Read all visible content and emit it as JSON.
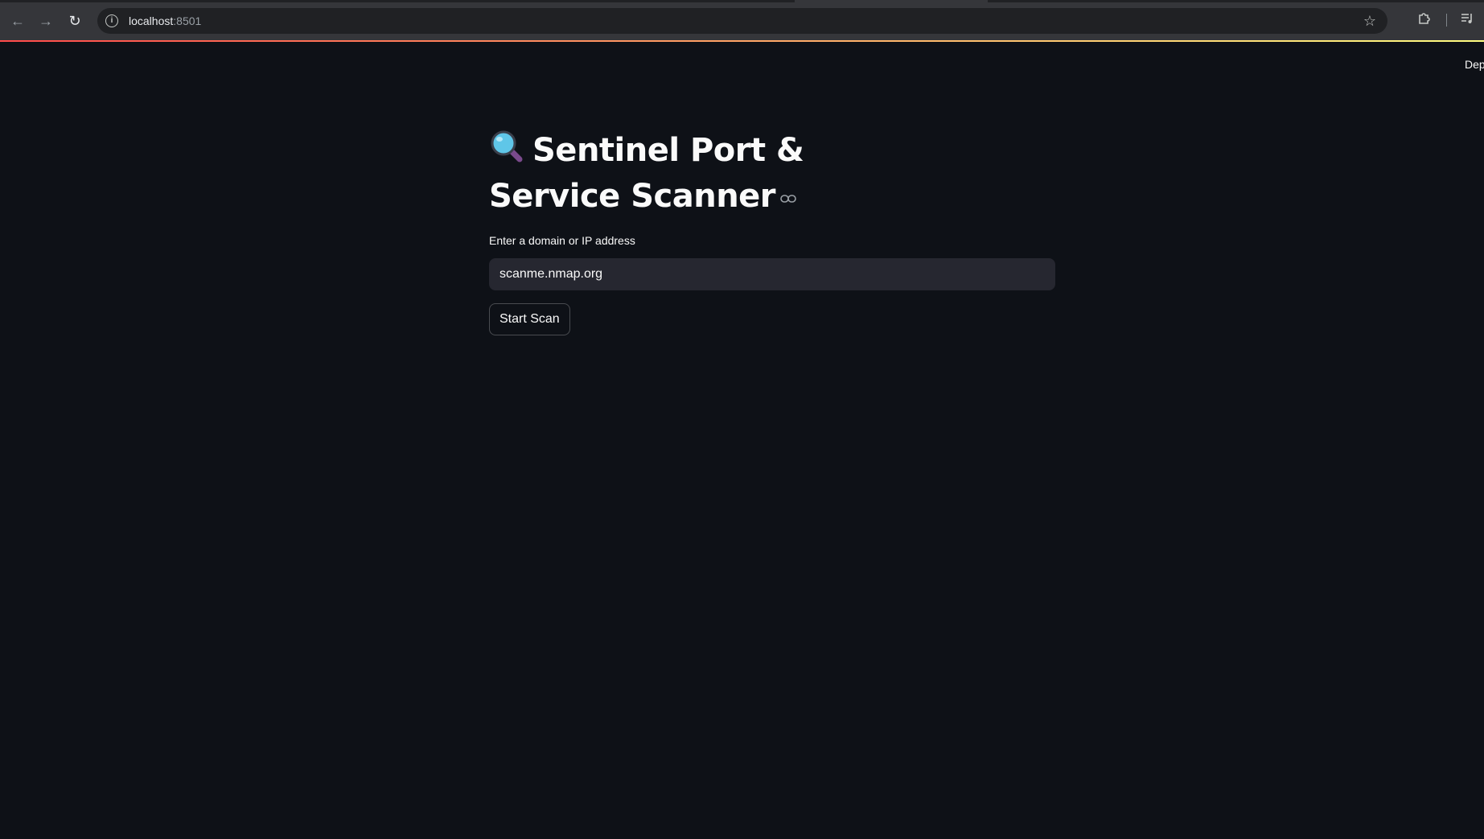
{
  "browser": {
    "url_host": "localhost",
    "url_port": ":8501",
    "icons": {
      "back": "arrow-left-icon",
      "forward": "arrow-right-icon",
      "reload": "reload-icon",
      "site_info": "info-icon",
      "bookmark": "star-icon",
      "extensions": "puzzle-icon",
      "media": "media-queue-icon"
    }
  },
  "app": {
    "deploy_label": "Dep",
    "title": "Sentinel Port & Service Scanner",
    "title_icon": "magnifier-icon",
    "anchor_icon": "link-icon",
    "input_label": "Enter a domain or IP address",
    "input_value": "scanme.nmap.org",
    "button_label": "Start Scan"
  },
  "colors": {
    "background": "#0e1117",
    "input_bg": "#262730",
    "text": "#fafafa",
    "accent_gradient_start": "#ff4b4b",
    "accent_gradient_end": "#fffd80"
  }
}
